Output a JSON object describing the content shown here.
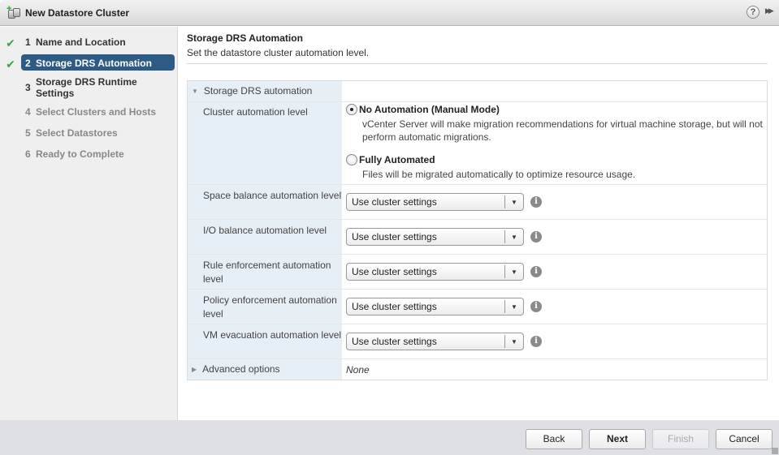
{
  "window": {
    "title": "New Datastore Cluster",
    "app_icon": "datastore-cluster-add-icon",
    "help_icon": "help-icon",
    "expand_icon": "expand-icon"
  },
  "steps": [
    {
      "num": "1",
      "label": "Name and Location",
      "state": "done"
    },
    {
      "num": "2",
      "label": "Storage DRS Automation",
      "state": "current"
    },
    {
      "num": "3",
      "label": "Storage DRS Runtime Settings",
      "label_line1": "Storage DRS Runtime",
      "label_line2": "Settings",
      "state": "next"
    },
    {
      "num": "4",
      "label": "Select Clusters and Hosts",
      "state": "pending"
    },
    {
      "num": "5",
      "label": "Select Datastores",
      "state": "pending"
    },
    {
      "num": "6",
      "label": "Ready to Complete",
      "state": "pending"
    }
  ],
  "page": {
    "title": "Storage DRS Automation",
    "subtitle": "Set the datastore cluster automation level."
  },
  "section": {
    "label": "Storage DRS automation",
    "cluster_automation": {
      "label": "Cluster automation level",
      "options": [
        {
          "label": "No Automation (Manual Mode)",
          "desc": "vCenter Server will make migration recommendations for virtual machine storage, but will not perform automatic migrations.",
          "checked": true
        },
        {
          "label": "Fully Automated",
          "desc": "Files will be migrated automatically to optimize resource usage.",
          "checked": false
        }
      ]
    },
    "settings": [
      {
        "label": "Space balance automation level",
        "value": "Use cluster settings"
      },
      {
        "label": "I/O balance automation level",
        "value": "Use cluster settings"
      },
      {
        "label": "Rule enforcement automation level",
        "value": "Use cluster settings"
      },
      {
        "label": "Policy enforcement automation level",
        "value": "Use cluster settings"
      },
      {
        "label": "VM evacuation automation level",
        "value": "Use cluster settings"
      }
    ],
    "advanced": {
      "label": "Advanced options",
      "value": "None"
    }
  },
  "footer": {
    "back": "Back",
    "next": "Next",
    "finish": "Finish",
    "cancel": "Cancel"
  }
}
